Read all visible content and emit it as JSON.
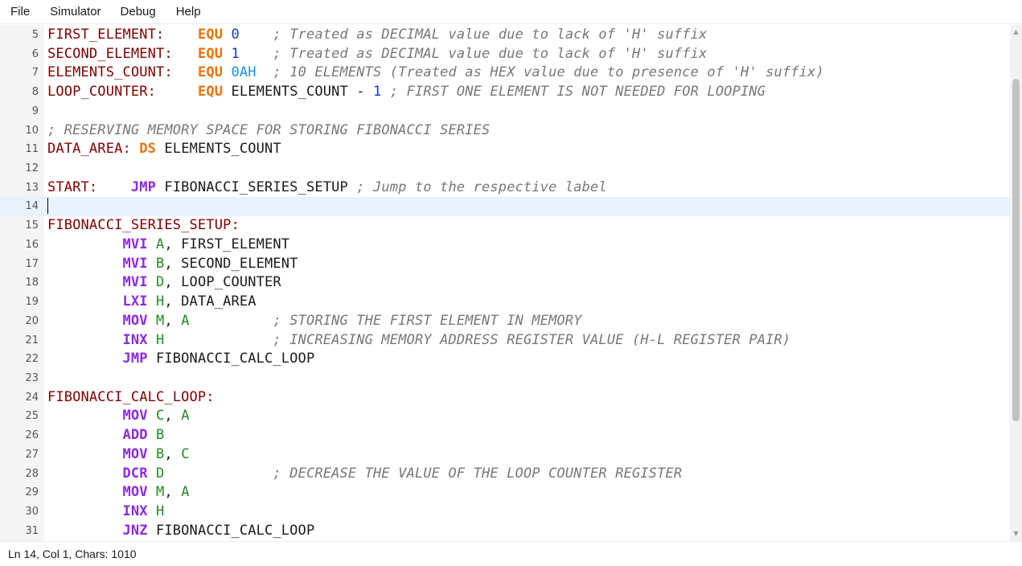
{
  "menu": {
    "items": [
      "File",
      "Simulator",
      "Debug",
      "Help"
    ]
  },
  "colors": {
    "label": "#800000",
    "directive": "#e8720c",
    "instruction": "#8a2be2",
    "register": "#228b22",
    "number": "#1034d6",
    "hex": "#1e8fe8",
    "comment": "#777777",
    "current_line": "#e8f2fc"
  },
  "editor": {
    "current_line": 14,
    "lines": [
      {
        "num": "5",
        "tokens": [
          [
            "label",
            "FIRST_ELEMENT:"
          ],
          [
            "ws",
            "    "
          ],
          [
            "directive",
            "EQU"
          ],
          [
            "ws",
            " "
          ],
          [
            "num",
            "0"
          ],
          [
            "ws",
            "    "
          ],
          [
            "comment",
            "; Treated as DECIMAL value due to lack of 'H' suffix"
          ]
        ]
      },
      {
        "num": "6",
        "tokens": [
          [
            "label",
            "SECOND_ELEMENT:"
          ],
          [
            "ws",
            "   "
          ],
          [
            "directive",
            "EQU"
          ],
          [
            "ws",
            " "
          ],
          [
            "num",
            "1"
          ],
          [
            "ws",
            "    "
          ],
          [
            "comment",
            "; Treated as DECIMAL value due to lack of 'H' suffix"
          ]
        ]
      },
      {
        "num": "7",
        "tokens": [
          [
            "label",
            "ELEMENTS_COUNT:"
          ],
          [
            "ws",
            "   "
          ],
          [
            "directive",
            "EQU"
          ],
          [
            "ws",
            " "
          ],
          [
            "hex",
            "0AH"
          ],
          [
            "ws",
            "  "
          ],
          [
            "comment",
            "; 10 ELEMENTS (Treated as HEX value due to presence of 'H' suffix)"
          ]
        ]
      },
      {
        "num": "8",
        "tokens": [
          [
            "label",
            "LOOP_COUNTER:"
          ],
          [
            "ws",
            "     "
          ],
          [
            "directive",
            "EQU"
          ],
          [
            "ws",
            " "
          ],
          [
            "ident",
            "ELEMENTS_COUNT - "
          ],
          [
            "num",
            "1"
          ],
          [
            "ws",
            " "
          ],
          [
            "comment",
            "; FIRST ONE ELEMENT IS NOT NEEDED FOR LOOPING"
          ]
        ]
      },
      {
        "num": "9",
        "tokens": []
      },
      {
        "num": "10",
        "tokens": [
          [
            "comment",
            "; RESERVING MEMORY SPACE FOR STORING FIBONACCI SERIES"
          ]
        ]
      },
      {
        "num": "11",
        "tokens": [
          [
            "label",
            "DATA_AREA:"
          ],
          [
            "ws",
            " "
          ],
          [
            "directive",
            "DS"
          ],
          [
            "ws",
            " "
          ],
          [
            "ident",
            "ELEMENTS_COUNT"
          ]
        ]
      },
      {
        "num": "12",
        "tokens": []
      },
      {
        "num": "13",
        "tokens": [
          [
            "label",
            "START:"
          ],
          [
            "ws",
            "    "
          ],
          [
            "instr",
            "JMP"
          ],
          [
            "ws",
            " "
          ],
          [
            "ident",
            "FIBONACCI_SERIES_SETUP"
          ],
          [
            "ws",
            " "
          ],
          [
            "comment",
            "; Jump to the respective label"
          ]
        ]
      },
      {
        "num": "14",
        "tokens": [],
        "cursor": true
      },
      {
        "num": "15",
        "tokens": [
          [
            "label",
            "FIBONACCI_SERIES_SETUP:"
          ]
        ]
      },
      {
        "num": "16",
        "tokens": [
          [
            "ws",
            "         "
          ],
          [
            "instr",
            "MVI"
          ],
          [
            "ws",
            " "
          ],
          [
            "reg",
            "A"
          ],
          [
            "ident",
            ", FIRST_ELEMENT"
          ]
        ]
      },
      {
        "num": "17",
        "tokens": [
          [
            "ws",
            "         "
          ],
          [
            "instr",
            "MVI"
          ],
          [
            "ws",
            " "
          ],
          [
            "reg",
            "B"
          ],
          [
            "ident",
            ", SECOND_ELEMENT"
          ]
        ]
      },
      {
        "num": "18",
        "tokens": [
          [
            "ws",
            "         "
          ],
          [
            "instr",
            "MVI"
          ],
          [
            "ws",
            " "
          ],
          [
            "reg",
            "D"
          ],
          [
            "ident",
            ", LOOP_COUNTER"
          ]
        ]
      },
      {
        "num": "19",
        "tokens": [
          [
            "ws",
            "         "
          ],
          [
            "instr",
            "LXI"
          ],
          [
            "ws",
            " "
          ],
          [
            "reg",
            "H"
          ],
          [
            "ident",
            ", DATA_AREA"
          ]
        ]
      },
      {
        "num": "20",
        "tokens": [
          [
            "ws",
            "         "
          ],
          [
            "instr",
            "MOV"
          ],
          [
            "ws",
            " "
          ],
          [
            "reg",
            "M"
          ],
          [
            "ident",
            ", "
          ],
          [
            "reg",
            "A"
          ],
          [
            "ws",
            "          "
          ],
          [
            "comment",
            "; STORING THE FIRST ELEMENT IN MEMORY"
          ]
        ]
      },
      {
        "num": "21",
        "tokens": [
          [
            "ws",
            "         "
          ],
          [
            "instr",
            "INX"
          ],
          [
            "ws",
            " "
          ],
          [
            "reg",
            "H"
          ],
          [
            "ws",
            "             "
          ],
          [
            "comment",
            "; INCREASING MEMORY ADDRESS REGISTER VALUE (H-L REGISTER PAIR)"
          ]
        ]
      },
      {
        "num": "22",
        "tokens": [
          [
            "ws",
            "         "
          ],
          [
            "instr",
            "JMP"
          ],
          [
            "ws",
            " "
          ],
          [
            "ident",
            "FIBONACCI_CALC_LOOP"
          ]
        ]
      },
      {
        "num": "23",
        "tokens": []
      },
      {
        "num": "24",
        "tokens": [
          [
            "label",
            "FIBONACCI_CALC_LOOP:"
          ]
        ]
      },
      {
        "num": "25",
        "tokens": [
          [
            "ws",
            "         "
          ],
          [
            "instr",
            "MOV"
          ],
          [
            "ws",
            " "
          ],
          [
            "reg",
            "C"
          ],
          [
            "ident",
            ", "
          ],
          [
            "reg",
            "A"
          ]
        ]
      },
      {
        "num": "26",
        "tokens": [
          [
            "ws",
            "         "
          ],
          [
            "instr",
            "ADD"
          ],
          [
            "ws",
            " "
          ],
          [
            "reg",
            "B"
          ]
        ]
      },
      {
        "num": "27",
        "tokens": [
          [
            "ws",
            "         "
          ],
          [
            "instr",
            "MOV"
          ],
          [
            "ws",
            " "
          ],
          [
            "reg",
            "B"
          ],
          [
            "ident",
            ", "
          ],
          [
            "reg",
            "C"
          ]
        ]
      },
      {
        "num": "28",
        "tokens": [
          [
            "ws",
            "         "
          ],
          [
            "instr",
            "DCR"
          ],
          [
            "ws",
            " "
          ],
          [
            "reg",
            "D"
          ],
          [
            "ws",
            "             "
          ],
          [
            "comment",
            "; DECREASE THE VALUE OF THE LOOP COUNTER REGISTER"
          ]
        ]
      },
      {
        "num": "29",
        "tokens": [
          [
            "ws",
            "         "
          ],
          [
            "instr",
            "MOV"
          ],
          [
            "ws",
            " "
          ],
          [
            "reg",
            "M"
          ],
          [
            "ident",
            ", "
          ],
          [
            "reg",
            "A"
          ]
        ]
      },
      {
        "num": "30",
        "tokens": [
          [
            "ws",
            "         "
          ],
          [
            "instr",
            "INX"
          ],
          [
            "ws",
            " "
          ],
          [
            "reg",
            "H"
          ]
        ]
      },
      {
        "num": "31",
        "tokens": [
          [
            "ws",
            "         "
          ],
          [
            "instr",
            "JNZ"
          ],
          [
            "ws",
            " "
          ],
          [
            "ident",
            "FIBONACCI_CALC_LOOP"
          ]
        ]
      }
    ]
  },
  "scrollbar": {
    "position_fraction": 0.11,
    "visible_fraction": 0.66
  },
  "status": {
    "text": "Ln 14, Col 1, Chars: 1010"
  }
}
